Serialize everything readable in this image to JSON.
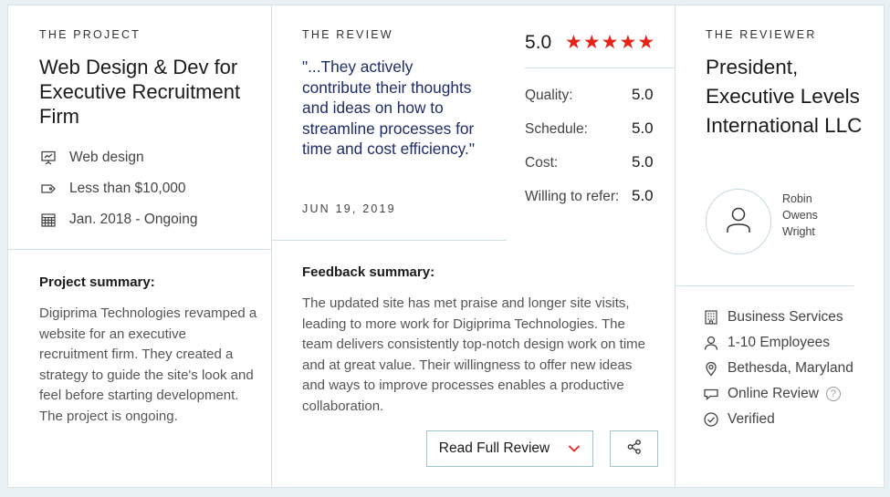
{
  "project": {
    "section_label": "THE PROJECT",
    "title": "Web Design & Dev for Executive Recruitment Firm",
    "meta": [
      {
        "icon": "presentation-icon",
        "text": "Web design"
      },
      {
        "icon": "tag-icon",
        "text": "Less than $10,000"
      },
      {
        "icon": "calendar-icon",
        "text": "Jan. 2018 - Ongoing"
      }
    ],
    "summary_heading": "Project summary:",
    "summary_text": "Digiprima Technologies revamped a website for an executive recruitment firm. They created a strategy to guide the site's look and feel before starting development. The project is ongoing."
  },
  "review": {
    "section_label": "THE REVIEW",
    "quote": "\"...They actively contribute their thoughts and ideas on how to streamline processes for time and cost efficiency.\"",
    "date": "JUN 19, 2019",
    "overall_score": "5.0",
    "stars": 5,
    "ratings": [
      {
        "label": "Quality:",
        "value": "5.0"
      },
      {
        "label": "Schedule:",
        "value": "5.0"
      },
      {
        "label": "Cost:",
        "value": "5.0"
      },
      {
        "label": "Willing to refer:",
        "value": "5.0"
      }
    ],
    "feedback_heading": "Feedback summary:",
    "feedback_text": "The updated site has met praise and longer site visits, leading to more work for Digiprima Technologies. The team delivers consistently top-notch design work on time and at great value. Their willingness to offer new ideas and ways to improve processes enables a productive collaboration.",
    "read_full_label": "Read Full Review"
  },
  "reviewer": {
    "section_label": "THE REVIEWER",
    "title": "President, Executive Levels International LLC",
    "name": "Robin Owens Wright",
    "info": [
      {
        "icon": "building-icon",
        "text": "Business Services"
      },
      {
        "icon": "person-icon",
        "text": "1-10 Employees"
      },
      {
        "icon": "location-pin-icon",
        "text": "Bethesda, Maryland"
      },
      {
        "icon": "chat-bubble-icon",
        "text": "Online Review"
      },
      {
        "icon": "check-circle-icon",
        "text": "Verified"
      }
    ]
  },
  "colors": {
    "star": "#e62415",
    "quote": "#1d2c6b",
    "divider": "#cfe0e6",
    "button_border": "#9ec3cf"
  }
}
